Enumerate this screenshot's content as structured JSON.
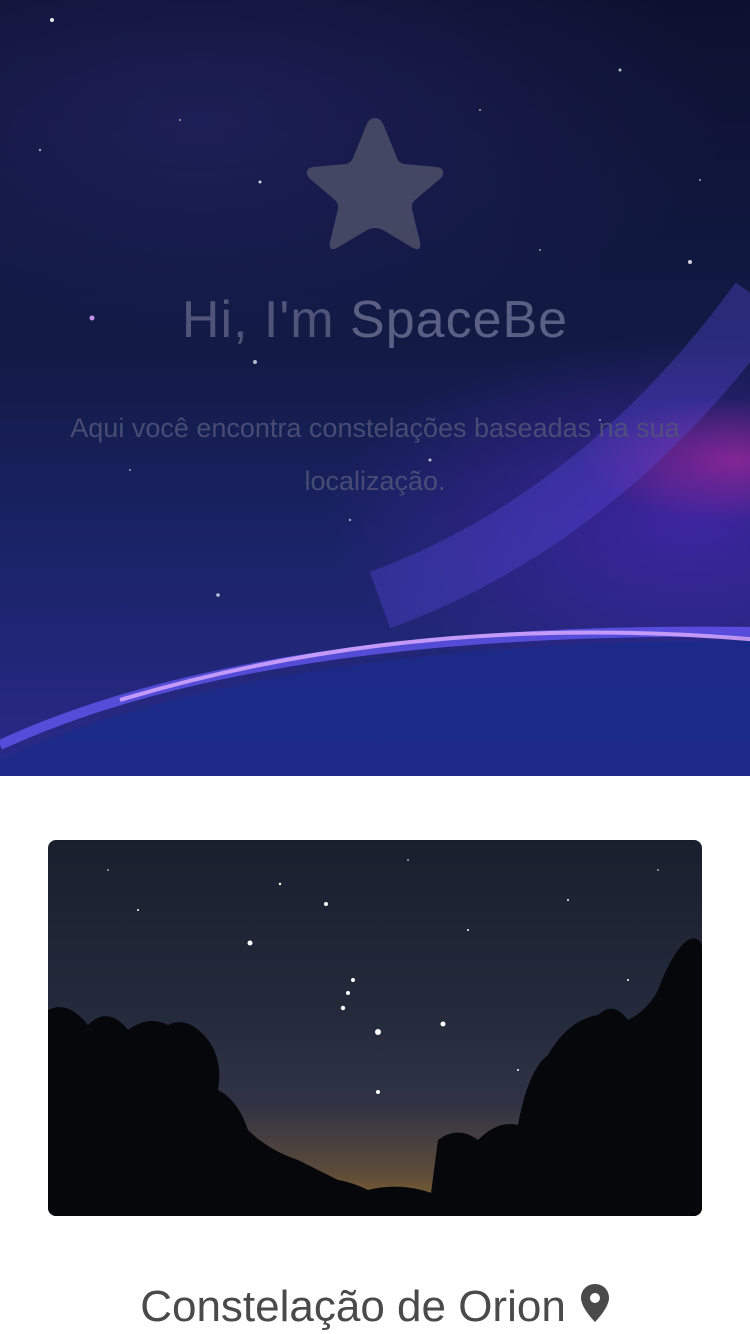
{
  "hero": {
    "icon": "star-icon",
    "title_prefix": "Hi, I'm ",
    "title_brand": "SpaceBe",
    "subtitle": "Aqui você encontra constelações baseadas na sua localização."
  },
  "card": {
    "image_subject": "Orion constellation night sky over tree silhouettes",
    "title": "Constelação de Orion",
    "location_icon": "map-pin-icon"
  }
}
